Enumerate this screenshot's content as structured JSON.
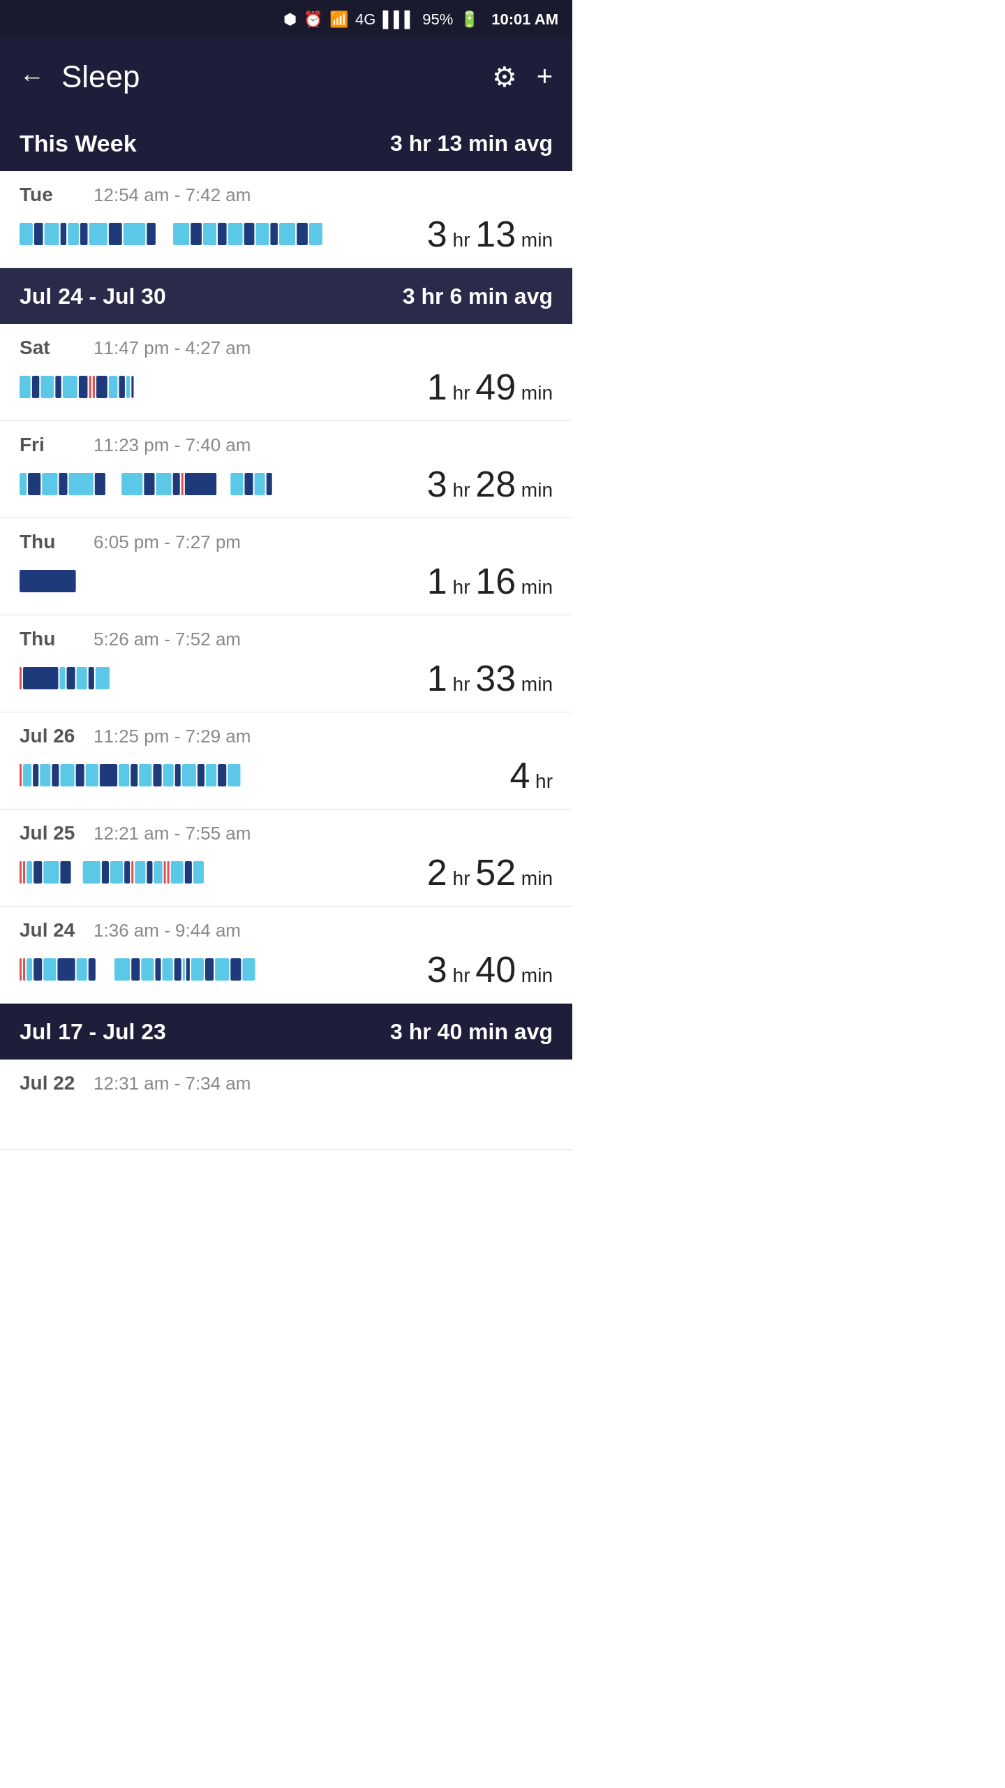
{
  "statusBar": {
    "battery": "95%",
    "time": "10:01 AM",
    "icons": [
      "bluetooth",
      "alarm",
      "wifi",
      "lte",
      "signal",
      "battery"
    ]
  },
  "header": {
    "title": "Sleep",
    "back_label": "←",
    "settings_label": "⚙",
    "add_label": "+"
  },
  "thisWeek": {
    "label": "This Week",
    "avg": "3 hr 13 min avg",
    "entries": [
      {
        "day": "Tue",
        "timeRange": "12:54 am - 7:42 am",
        "durationBig": "3",
        "durationUnit1": "hr",
        "durationSmall": "13",
        "durationUnit2": "min",
        "barType": "mixed_light_dark"
      }
    ]
  },
  "week1": {
    "label": "Jul 24 - Jul 30",
    "avg": "3 hr 6 min avg",
    "entries": [
      {
        "day": "Sat",
        "timeRange": "11:47 pm - 4:27 am",
        "durationBig": "1",
        "durationUnit1": "hr",
        "durationSmall": "49",
        "durationUnit2": "min",
        "barType": "short_mixed"
      },
      {
        "day": "Fri",
        "timeRange": "11:23 pm - 7:40 am",
        "durationBig": "3",
        "durationUnit1": "hr",
        "durationSmall": "28",
        "durationUnit2": "min",
        "barType": "long_mixed"
      },
      {
        "day": "Thu",
        "timeRange": "6:05 pm - 7:27 pm",
        "durationBig": "1",
        "durationUnit1": "hr",
        "durationSmall": "16",
        "durationUnit2": "min",
        "barType": "very_short_dark"
      },
      {
        "day": "Thu",
        "timeRange": "5:26 am - 7:52 am",
        "durationBig": "1",
        "durationUnit1": "hr",
        "durationSmall": "33",
        "durationUnit2": "min",
        "barType": "short_with_red"
      },
      {
        "day": "Jul 26",
        "timeRange": "11:25 pm - 7:29 am",
        "durationBig": "4",
        "durationUnit1": "hr",
        "durationSmall": "",
        "durationUnit2": "",
        "barType": "long_with_red_start"
      },
      {
        "day": "Jul 25",
        "timeRange": "12:21 am - 7:55 am",
        "durationBig": "2",
        "durationUnit1": "hr",
        "durationSmall": "52",
        "durationUnit2": "min",
        "barType": "mixed_with_reds"
      },
      {
        "day": "Jul 24",
        "timeRange": "1:36 am - 9:44 am",
        "durationBig": "3",
        "durationUnit1": "hr",
        "durationSmall": "40",
        "durationUnit2": "min",
        "barType": "mixed_red_start"
      }
    ]
  },
  "week2": {
    "label": "Jul 17 - Jul 23",
    "avg": "3 hr 40 min avg",
    "entries": [
      {
        "day": "Jul 22",
        "timeRange": "12:31 am - 7:34 am",
        "durationBig": "",
        "durationUnit1": "",
        "durationSmall": "",
        "durationUnit2": "",
        "barType": "none"
      }
    ]
  },
  "colors": {
    "light_blue": "#5bc8e8",
    "dark_blue": "#1e3a7a",
    "red": "#e05050",
    "header_bg": "#1e1e3a",
    "section_bg": "#2a2a4a"
  }
}
